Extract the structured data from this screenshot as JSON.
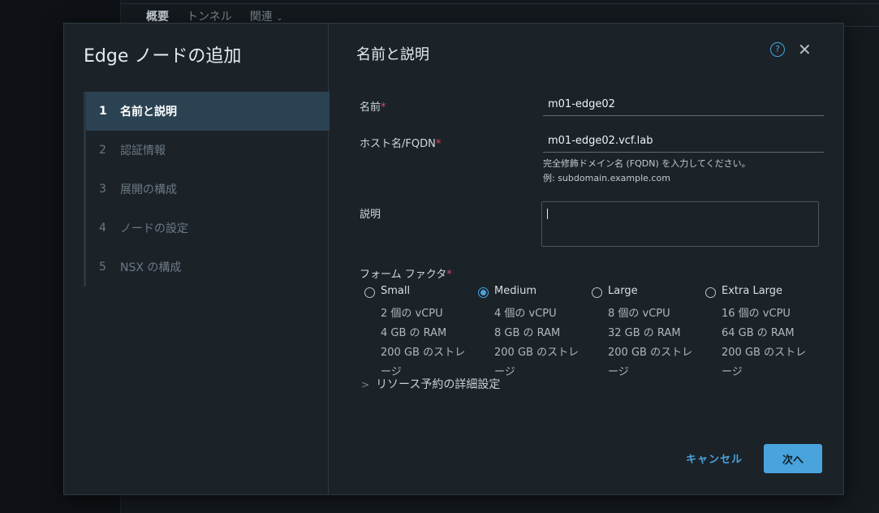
{
  "background": {
    "tabs": [
      "概要",
      "トンネル",
      "関連"
    ]
  },
  "modal": {
    "title": "Edge ノードの追加",
    "steps": [
      {
        "num": "1",
        "label": "名前と説明"
      },
      {
        "num": "2",
        "label": "認証情報"
      },
      {
        "num": "3",
        "label": "展開の構成"
      },
      {
        "num": "4",
        "label": "ノードの設定"
      },
      {
        "num": "5",
        "label": "NSX の構成"
      }
    ],
    "content_title": "名前と説明",
    "help_icon": "?",
    "close_icon": "✕",
    "form": {
      "name_label": "名前",
      "name_value": "m01-edge02",
      "host_label": "ホスト名/FQDN",
      "host_value": "m01-edge02.vcf.lab",
      "host_hint_1": "完全修飾ドメイン名 (FQDN) を入力してください。",
      "host_hint_2": "例: subdomain.example.com",
      "desc_label": "説明",
      "desc_value": "",
      "form_factor_label": "フォーム ファクタ",
      "required_mark": "*",
      "form_factor_options": [
        {
          "name": "Small",
          "cpu": "2 個の vCPU",
          "ram": "4 GB の RAM",
          "storage_1": "200 GB のストレ",
          "storage_2": "ージ",
          "selected": false
        },
        {
          "name": "Medium",
          "cpu": "4 個の vCPU",
          "ram": "8 GB の RAM",
          "storage_1": "200 GB のストレ",
          "storage_2": "ージ",
          "selected": true
        },
        {
          "name": "Large",
          "cpu": "8 個の vCPU",
          "ram": "32 GB の RAM",
          "storage_1": "200 GB のストレ",
          "storage_2": "ージ",
          "selected": false
        },
        {
          "name": "Extra Large",
          "cpu": "16 個の vCPU",
          "ram": "64 GB の RAM",
          "storage_1": "200 GB のストレ",
          "storage_2": "ージ",
          "selected": false
        }
      ],
      "advanced_label": "リソース予約の詳細設定"
    },
    "buttons": {
      "cancel": "キャンセル",
      "next": "次へ"
    }
  },
  "colors": {
    "accent": "#49a3dc",
    "required": "#e0465a",
    "active_step_bg": "#2b4253"
  }
}
